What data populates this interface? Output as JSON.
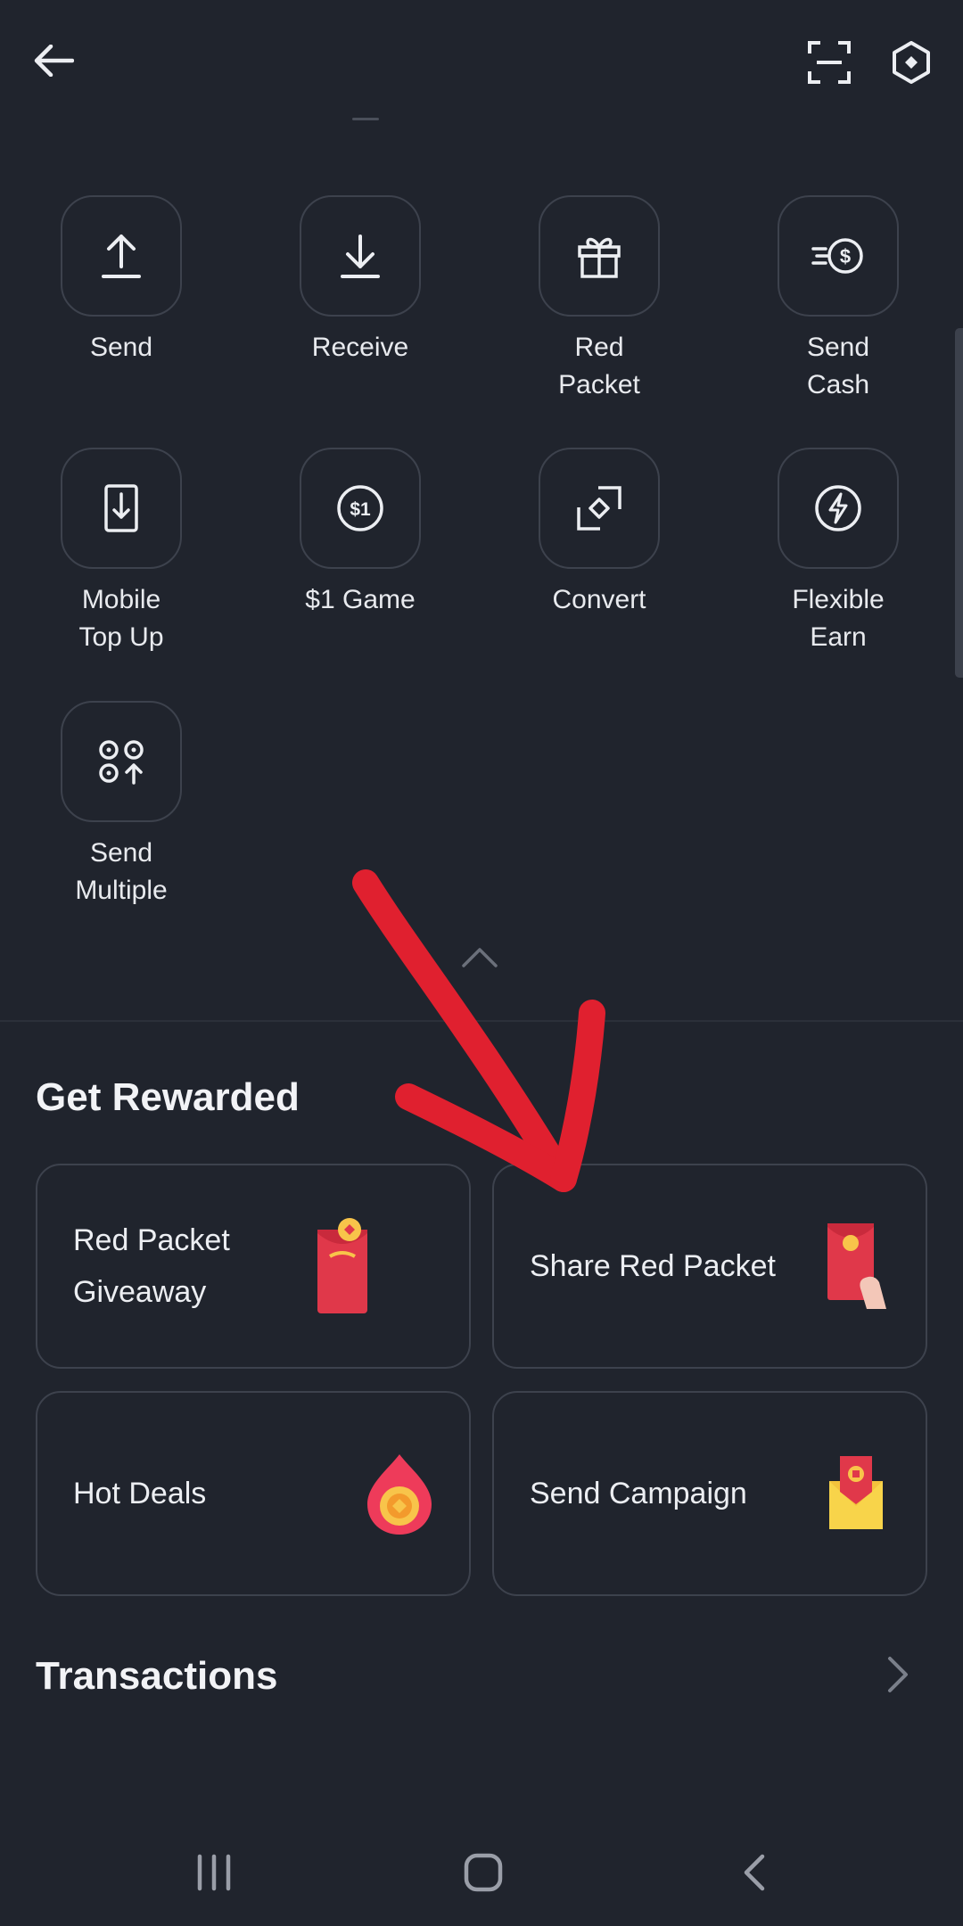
{
  "header": {
    "back_icon": "arrow-left-icon",
    "scan_icon": "scan-icon",
    "settings_icon": "hexagon-settings-icon"
  },
  "actions": [
    {
      "label": "Send",
      "icon": "upload-icon"
    },
    {
      "label": "Receive",
      "icon": "download-icon"
    },
    {
      "label": "Red\nPacket",
      "icon": "gift-icon"
    },
    {
      "label": "Send\nCash",
      "icon": "cash-coin-icon"
    },
    {
      "label": "Mobile\nTop Up",
      "icon": "phone-topup-icon"
    },
    {
      "label": "$1 Game",
      "icon": "dollar-coin-icon"
    },
    {
      "label": "Convert",
      "icon": "convert-icon"
    },
    {
      "label": "Flexible\nEarn",
      "icon": "lightning-icon"
    },
    {
      "label": "Send\nMultiple",
      "icon": "multiple-coins-icon"
    }
  ],
  "rewards": {
    "title": "Get Rewarded",
    "cards": [
      {
        "label": "Red Packet Giveaway",
        "icon": "red-packet-giveaway-icon"
      },
      {
        "label": "Share Red Packet",
        "icon": "share-red-packet-icon"
      },
      {
        "label": "Hot Deals",
        "icon": "flame-icon"
      },
      {
        "label": "Send Campaign",
        "icon": "campaign-envelope-icon"
      }
    ]
  },
  "transactions": {
    "title": "Transactions",
    "chevron_icon": "chevron-right-icon"
  },
  "colors": {
    "background": "#20242d",
    "tile_border": "#3d424d",
    "annotation_red": "#e0202f"
  },
  "navbar": {
    "recents_icon": "recents-icon",
    "home_icon": "home-icon",
    "back_icon": "nav-back-icon"
  }
}
